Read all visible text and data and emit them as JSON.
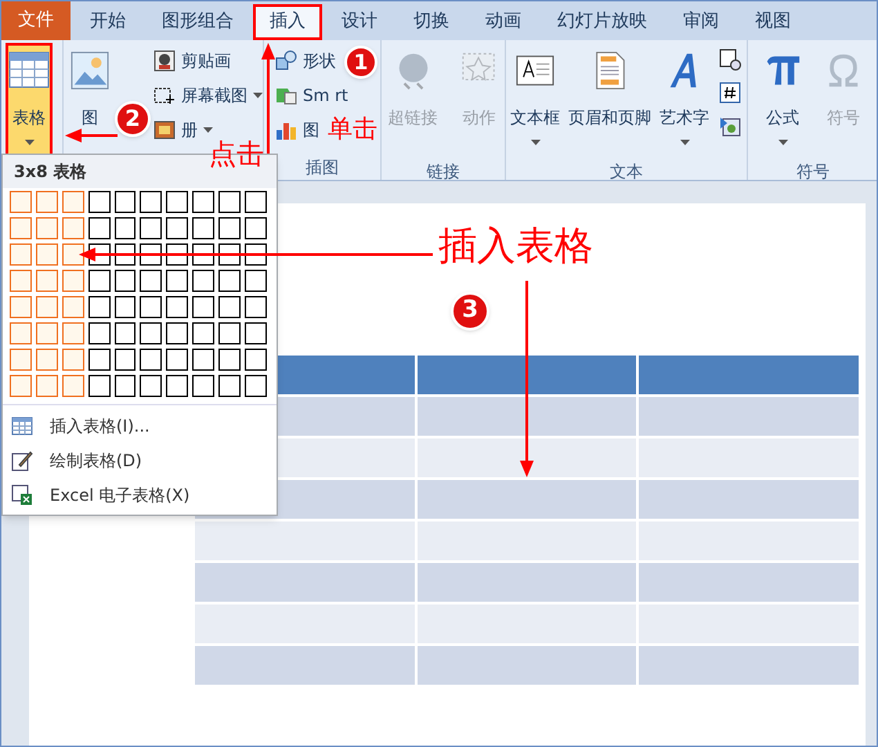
{
  "tabs": [
    {
      "label": "文件",
      "kind": "file",
      "selected": false
    },
    {
      "label": "开始",
      "kind": "tab",
      "selected": false
    },
    {
      "label": "图形组合",
      "kind": "tab",
      "selected": false
    },
    {
      "label": "插入",
      "kind": "tab",
      "selected": true
    },
    {
      "label": "设计",
      "kind": "tab",
      "selected": false
    },
    {
      "label": "切换",
      "kind": "tab",
      "selected": false
    },
    {
      "label": "动画",
      "kind": "tab",
      "selected": false
    },
    {
      "label": "幻灯片放映",
      "kind": "tab",
      "selected": false
    },
    {
      "label": "审阅",
      "kind": "tab",
      "selected": false
    },
    {
      "label": "视图",
      "kind": "tab",
      "selected": false
    }
  ],
  "ribbon_groups": [
    {
      "buttons": [
        {
          "kind": "large",
          "label": "表格",
          "dropdown": true,
          "disabled": false,
          "selected": true
        }
      ]
    },
    {
      "buttons": [
        {
          "kind": "large",
          "label": "图",
          "dropdown": false,
          "disabled": false,
          "selected": false
        },
        {
          "kind": "small",
          "label": "剪贴画",
          "dropdown": false,
          "disabled": false,
          "selected": false
        },
        {
          "kind": "small",
          "label": "屏幕截图",
          "dropdown": true,
          "disabled": false,
          "selected": false
        },
        {
          "kind": "small",
          "label": "册",
          "dropdown": true,
          "disabled": false,
          "selected": false
        }
      ]
    },
    {
      "label": "插图",
      "buttons": [
        {
          "kind": "small",
          "label": "形状",
          "dropdown": false,
          "disabled": false,
          "selected": false
        },
        {
          "kind": "small",
          "label": "Sm rt",
          "dropdown": false,
          "disabled": false,
          "selected": false
        },
        {
          "kind": "small",
          "label": "图",
          "dropdown": false,
          "disabled": false,
          "selected": false
        }
      ]
    },
    {
      "label": "链接",
      "buttons": [
        {
          "kind": "large",
          "label": "超链接",
          "dropdown": false,
          "disabled": true,
          "selected": false
        },
        {
          "kind": "large",
          "label": "动作",
          "dropdown": false,
          "disabled": true,
          "selected": false
        }
      ]
    },
    {
      "label": "文本",
      "buttons": [
        {
          "kind": "large",
          "label": "文本框",
          "dropdown": true,
          "disabled": false,
          "selected": false
        },
        {
          "kind": "large",
          "label": "页眉和页脚",
          "dropdown": false,
          "disabled": false,
          "selected": false
        },
        {
          "kind": "large",
          "label": "艺术字",
          "dropdown": true,
          "disabled": false,
          "selected": false
        },
        {
          "kind": "tiny",
          "disabled": false,
          "selected": false
        },
        {
          "kind": "tiny",
          "disabled": false,
          "selected": false
        },
        {
          "kind": "tiny",
          "disabled": false,
          "selected": false
        }
      ]
    },
    {
      "label": "符号",
      "buttons": [
        {
          "kind": "large",
          "label": "公式",
          "dropdown": true,
          "disabled": false,
          "selected": false
        },
        {
          "kind": "large",
          "label": "符号",
          "dropdown": false,
          "disabled": true,
          "selected": false
        }
      ]
    }
  ],
  "table_menu": {
    "title": "3x8 表格",
    "grid": [
      [
        {
          "selected": true
        },
        {
          "selected": true
        },
        {
          "selected": true
        },
        {
          "selected": false
        },
        {
          "selected": false
        },
        {
          "selected": false
        },
        {
          "selected": false
        },
        {
          "selected": false
        },
        {
          "selected": false
        },
        {
          "selected": false
        }
      ],
      [
        {
          "selected": true
        },
        {
          "selected": true
        },
        {
          "selected": true
        },
        {
          "selected": false
        },
        {
          "selected": false
        },
        {
          "selected": false
        },
        {
          "selected": false
        },
        {
          "selected": false
        },
        {
          "selected": false
        },
        {
          "selected": false
        }
      ],
      [
        {
          "selected": true
        },
        {
          "selected": true
        },
        {
          "selected": true
        },
        {
          "selected": false
        },
        {
          "selected": false
        },
        {
          "selected": false
        },
        {
          "selected": false
        },
        {
          "selected": false
        },
        {
          "selected": false
        },
        {
          "selected": false
        }
      ],
      [
        {
          "selected": true
        },
        {
          "selected": true
        },
        {
          "selected": true
        },
        {
          "selected": false
        },
        {
          "selected": false
        },
        {
          "selected": false
        },
        {
          "selected": false
        },
        {
          "selected": false
        },
        {
          "selected": false
        },
        {
          "selected": false
        }
      ],
      [
        {
          "selected": true
        },
        {
          "selected": true
        },
        {
          "selected": true
        },
        {
          "selected": false
        },
        {
          "selected": false
        },
        {
          "selected": false
        },
        {
          "selected": false
        },
        {
          "selected": false
        },
        {
          "selected": false
        },
        {
          "selected": false
        }
      ],
      [
        {
          "selected": true
        },
        {
          "selected": true
        },
        {
          "selected": true
        },
        {
          "selected": false
        },
        {
          "selected": false
        },
        {
          "selected": false
        },
        {
          "selected": false
        },
        {
          "selected": false
        },
        {
          "selected": false
        },
        {
          "selected": false
        }
      ],
      [
        {
          "selected": true
        },
        {
          "selected": true
        },
        {
          "selected": true
        },
        {
          "selected": false
        },
        {
          "selected": false
        },
        {
          "selected": false
        },
        {
          "selected": false
        },
        {
          "selected": false
        },
        {
          "selected": false
        },
        {
          "selected": false
        }
      ],
      [
        {
          "selected": true
        },
        {
          "selected": true
        },
        {
          "selected": true
        },
        {
          "selected": false
        },
        {
          "selected": false
        },
        {
          "selected": false
        },
        {
          "selected": false
        },
        {
          "selected": false
        },
        {
          "selected": false
        },
        {
          "selected": false
        }
      ]
    ],
    "items": [
      {
        "label": "插入表格(I)..."
      },
      {
        "label": "绘制表格(D)"
      },
      {
        "label": "Excel 电子表格(X)"
      }
    ]
  },
  "annotations": [
    {
      "kind": "circle",
      "text": "1"
    },
    {
      "kind": "circle",
      "text": "2"
    },
    {
      "kind": "circle",
      "text": "3"
    },
    {
      "kind": "note",
      "text": "点击"
    },
    {
      "kind": "note",
      "text": "单击"
    },
    {
      "kind": "note",
      "text": "插入表格"
    }
  ]
}
